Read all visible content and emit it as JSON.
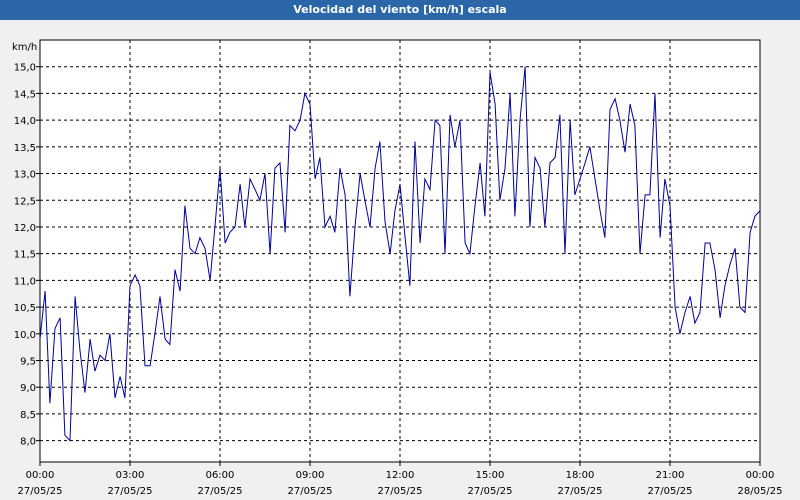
{
  "window": {
    "title": "Velocidad del viento [km/h] escala"
  },
  "chart_data": {
    "type": "line",
    "title": "Velocidad del viento [km/h] escala",
    "ylabel": "km/h",
    "xlabel": "",
    "ylim": [
      7.6,
      15.5
    ],
    "xlim": [
      0,
      24
    ],
    "grid": true,
    "y_ticks": [
      "8,0",
      "8,5",
      "9,0",
      "9,5",
      "10,0",
      "10,5",
      "11,0",
      "11,5",
      "12,0",
      "12,5",
      "13,0",
      "13,5",
      "14,0",
      "14,5",
      "15,0"
    ],
    "y_tick_values": [
      8.0,
      8.5,
      9.0,
      9.5,
      10.0,
      10.5,
      11.0,
      11.5,
      12.0,
      12.5,
      13.0,
      13.5,
      14.0,
      14.5,
      15.0
    ],
    "x_tick_values": [
      0,
      3,
      6,
      9,
      12,
      15,
      18,
      21,
      24
    ],
    "x_ticks": [
      {
        "time": "00:00",
        "date": "27/05/25"
      },
      {
        "time": "03:00",
        "date": "27/05/25"
      },
      {
        "time": "06:00",
        "date": "27/05/25"
      },
      {
        "time": "09:00",
        "date": "27/05/25"
      },
      {
        "time": "12:00",
        "date": "27/05/25"
      },
      {
        "time": "15:00",
        "date": "27/05/25"
      },
      {
        "time": "18:00",
        "date": "27/05/25"
      },
      {
        "time": "21:00",
        "date": "27/05/25"
      },
      {
        "time": "00:00",
        "date": "28/05/25"
      }
    ],
    "colors": {
      "line": "#00009c",
      "grid": "#000000",
      "background": "#ffffff"
    },
    "series": [
      {
        "x": [
          0.0,
          0.17,
          0.33,
          0.5,
          0.67,
          0.83,
          1.0,
          1.17,
          1.33,
          1.5,
          1.67,
          1.83,
          2.0,
          2.17,
          2.33,
          2.5,
          2.67,
          2.83,
          3.0,
          3.17,
          3.33,
          3.5,
          3.67,
          3.83,
          4.0,
          4.17,
          4.33,
          4.5,
          4.67,
          4.83,
          5.0,
          5.17,
          5.33,
          5.5,
          5.67,
          5.83,
          6.0,
          6.17,
          6.33,
          6.5,
          6.67,
          6.83,
          7.0,
          7.17,
          7.33,
          7.5,
          7.67,
          7.83,
          8.0,
          8.17,
          8.33,
          8.5,
          8.67,
          8.83,
          9.0,
          9.17,
          9.33,
          9.5,
          9.67,
          9.83,
          10.0,
          10.17,
          10.33,
          10.5,
          10.67,
          10.83,
          11.0,
          11.17,
          11.33,
          11.5,
          11.67,
          11.83,
          12.0,
          12.17,
          12.33,
          12.5,
          12.67,
          12.83,
          13.0,
          13.17,
          13.33,
          13.5,
          13.67,
          13.83,
          14.0,
          14.17,
          14.33,
          14.5,
          14.67,
          14.83,
          15.0,
          15.17,
          15.33,
          15.5,
          15.67,
          15.83,
          16.0,
          16.17,
          16.33,
          16.5,
          16.67,
          16.83,
          17.0,
          17.17,
          17.33,
          17.5,
          17.67,
          17.83,
          18.0,
          18.17,
          18.33,
          18.5,
          18.67,
          18.83,
          19.0,
          19.17,
          19.33,
          19.5,
          19.67,
          19.83,
          20.0,
          20.17,
          20.33,
          20.5,
          20.67,
          20.83,
          21.0,
          21.17,
          21.33,
          21.5,
          21.67,
          21.83,
          22.0,
          22.17,
          22.33,
          22.5,
          22.67,
          22.83,
          23.0,
          23.17,
          23.33,
          23.5,
          23.67,
          23.83,
          24.0
        ],
        "values": [
          9.9,
          10.8,
          8.7,
          10.1,
          10.3,
          8.1,
          8.0,
          10.7,
          9.7,
          8.9,
          9.9,
          9.3,
          9.6,
          9.5,
          10.0,
          8.8,
          9.2,
          8.8,
          10.9,
          11.1,
          10.9,
          9.4,
          9.4,
          10.0,
          10.7,
          9.9,
          9.8,
          11.2,
          10.8,
          12.4,
          11.6,
          11.5,
          11.8,
          11.6,
          11.0,
          12.0,
          13.1,
          11.7,
          11.9,
          12.0,
          12.8,
          12.0,
          12.9,
          12.7,
          12.5,
          13.0,
          11.5,
          13.1,
          13.2,
          11.9,
          13.9,
          13.8,
          14.0,
          14.5,
          14.3,
          12.9,
          13.3,
          12.0,
          12.2,
          11.9,
          13.1,
          12.6,
          10.7,
          12.0,
          13.0,
          12.5,
          12.0,
          13.1,
          13.6,
          12.1,
          11.5,
          12.3,
          12.8,
          11.8,
          10.9,
          13.6,
          11.7,
          12.9,
          12.7,
          14.0,
          13.9,
          11.5,
          14.1,
          13.5,
          14.0,
          11.7,
          11.5,
          12.4,
          13.2,
          12.2,
          14.9,
          14.3,
          12.5,
          13.1,
          14.5,
          12.2,
          14.0,
          15.0,
          12.0,
          13.3,
          13.1,
          12.0,
          13.2,
          13.3,
          14.1,
          11.5,
          14.0,
          12.6,
          12.9,
          13.2,
          13.5,
          12.9,
          12.3,
          11.8,
          14.2,
          14.4,
          14.0,
          13.4,
          14.3,
          13.9,
          11.5,
          12.6,
          12.6,
          14.5,
          11.8,
          12.9,
          12.4,
          10.5,
          10.0,
          10.4,
          10.7,
          10.2,
          10.4,
          11.7,
          11.7,
          11.2,
          10.3,
          10.9,
          11.3,
          11.6,
          10.5,
          10.4,
          11.9,
          12.2,
          12.3
        ]
      }
    ]
  }
}
